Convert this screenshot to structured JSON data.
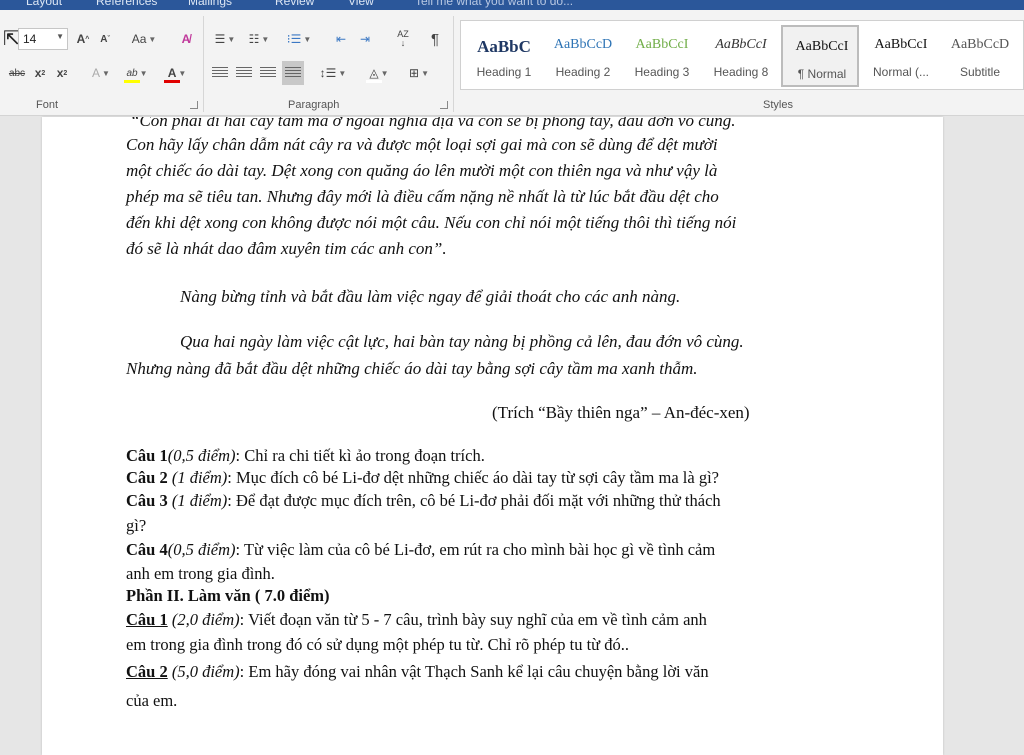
{
  "tabs": [
    "Layout",
    "References",
    "Mailings",
    "Review",
    "View"
  ],
  "tell_me": "Tell me what you want to do...",
  "ribbon": {
    "font_size": "14",
    "font_label": "Font",
    "paragraph_label": "Paragraph",
    "styles_label": "Styles",
    "grow_font": "A",
    "shrink_font": "A",
    "change_case": "Aa",
    "strike": "abc",
    "subscript": "x",
    "superscript": "x",
    "subscript_mark": "2",
    "superscript_mark": "2",
    "highlight": "ab",
    "font_color": "A",
    "pilcrow": "¶",
    "sort": "↓",
    "sort_letters": "AZ",
    "text_effects": "A",
    "colors": {
      "highlight": "#ffff00",
      "font_color": "#e00000",
      "shading": "#ffffff"
    }
  },
  "styles": [
    {
      "sample": "AaBbC",
      "name": "Heading 1",
      "color": "#1f3864",
      "weight": "bold",
      "italic": false,
      "size": "17px"
    },
    {
      "sample": "AaBbCcD",
      "name": "Heading 2",
      "color": "#2e74b5",
      "weight": "normal",
      "italic": false,
      "size": "14px"
    },
    {
      "sample": "AaBbCcI",
      "name": "Heading 3",
      "color": "#70ad47",
      "weight": "normal",
      "italic": false,
      "size": "14px"
    },
    {
      "sample": "AaBbCcI",
      "name": "Heading 8",
      "color": "#333333",
      "weight": "normal",
      "italic": true,
      "size": "14px"
    },
    {
      "sample": "AaBbCcI",
      "name": "¶ Normal",
      "color": "#111111",
      "weight": "normal",
      "italic": false,
      "size": "14px"
    },
    {
      "sample": "AaBbCcI",
      "name": "Normal (...",
      "color": "#111111",
      "weight": "normal",
      "italic": false,
      "size": "14px"
    },
    {
      "sample": "AaBbCcD",
      "name": "Subtitle",
      "color": "#555555",
      "weight": "normal",
      "italic": false,
      "size": "14px"
    }
  ],
  "doc": {
    "lines_italic": [
      "“Con phải đi hái cây tầm ma ở ngoài nghĩa địa và con sẽ bị phỏng tay, đau đớn vô cùng.",
      "Con hãy lấy chân dẫm nát cây ra và được một loại sợi gai mà con sẽ dùng để dệt mười",
      "một chiếc áo dài tay. Dệt xong con quăng áo lên mười một con thiên nga và như vậy là",
      "phép ma sẽ tiêu tan. Nhưng đây mới là điều cấm nặng nề nhất là từ lúc bắt đầu dệt cho",
      "đến khi dệt xong con không được nói một câu. Nếu con chỉ nói một tiếng thôi thì tiếng nói",
      "đó sẽ là nhát dao đâm xuyên tim các anh con”."
    ],
    "para2": "Nàng bừng tỉnh và bắt đầu làm việc ngay để giải thoát cho các anh nàng.",
    "para3_line1": "Qua hai ngày làm việc cật lực, hai bàn tay nàng bị phồng cả lên, đau đớn vô cùng.",
    "para3_line2": "Nhưng nàng đã bắt đầu dệt những chiếc áo dài tay bằng sợi cây tầm ma xanh thẫm.",
    "citation": "(Trích “Bầy thiên nga” – An-đéc-xen)",
    "q1_label": "Câu 1",
    "q1_points": "(0,5 điểm)",
    "q1_text": ": Chỉ ra chi tiết kì ảo trong đoạn trích.",
    "q2_label": "Câu 2",
    "q2_points": "(1 điểm)",
    "q2_text": ": Mục đích cô bé Li-đơ dệt những chiếc áo dài tay từ sợi cây tầm ma là gì?",
    "q3_label": "Câu 3",
    "q3_points": "(1 điểm)",
    "q3_text": ": Để đạt được mục đích trên, cô bé Li-đơ phải đối mặt với những thử thách",
    "q3_cont": "gì?",
    "q4_label": "Câu 4",
    "q4_points": "(0,5 điểm)",
    "q4_text": ": Từ việc làm của cô bé Li-đơ, em rút ra cho mình bài học gì về tình cảm",
    "q4_cont": "anh em trong gia đình.",
    "part2": "Phần II. Làm văn ( 7.0 điểm)",
    "w1_label": "Câu 1",
    "w1_points": "(2,0 điểm)",
    "w1_text": ": Viết đoạn văn từ 5 - 7 câu, trình bày suy nghĩ của em về tình cảm anh",
    "w1_cont": "em trong gia đình trong đó có sử dụng một phép tu từ. Chỉ rõ phép tu từ đó..",
    "w2_label": "Câu 2",
    "w2_points": "(5,0 điểm)",
    "w2_text": ": Em hãy đóng vai nhân vật Thạch Sanh kể lại câu chuyện bằng lời văn",
    "w2_cont": "của em."
  }
}
